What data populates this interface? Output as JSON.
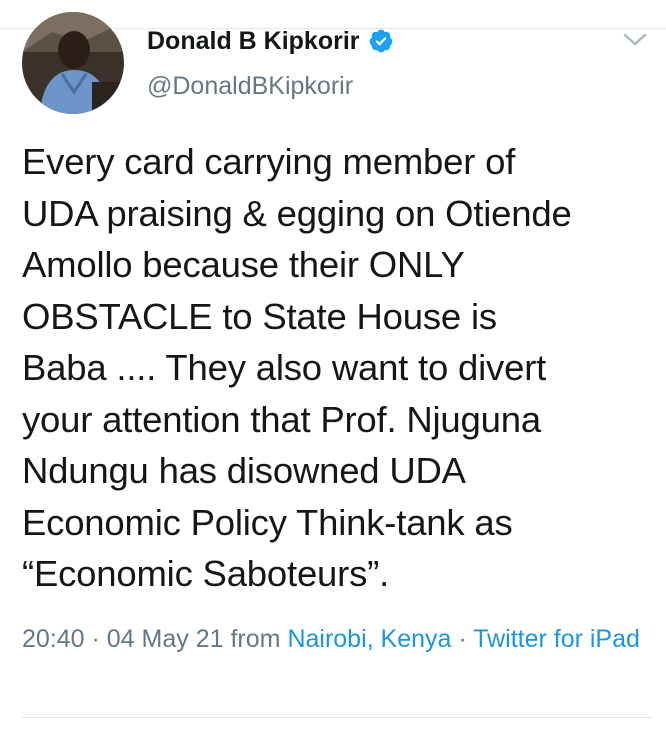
{
  "tweet": {
    "author": {
      "display_name": "Donald B Kipkorir",
      "handle": "@DonaldBKipkorir",
      "verified": true,
      "avatar_icon": "profile-photo"
    },
    "text": "Every card carrying member of\nUDA praising & egging on Otiende\nAmollo because their ONLY\nOBSTACLE to State House is\nBaba .... They also want to divert\nyour attention that Prof. Njuguna\nNdungu has disowned UDA\nEconomic Policy Think-tank as\n“Economic Saboteurs”.",
    "time": "20:40",
    "separator": " · ",
    "date": "04 May 21",
    "from_label": " from ",
    "location": "Nairobi, Kenya",
    "source": "Twitter for iPad",
    "menu_icon": "chevron-down-icon"
  },
  "colors": {
    "text": "#14171a",
    "secondary": "#657786",
    "link": "#1b95e0",
    "verified": "#1da1f2",
    "divider": "#e1e8ed"
  }
}
